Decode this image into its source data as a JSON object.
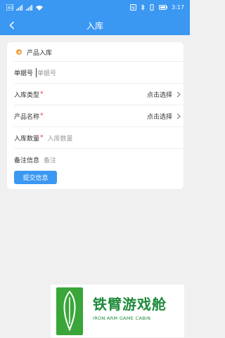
{
  "status_bar": {
    "time": "3:17",
    "battery": ""
  },
  "nav": {
    "title": "入库",
    "back_icon": "chevron-left-icon"
  },
  "card": {
    "section_title": "产品入库",
    "rows": [
      {
        "label": "单据号",
        "required": false,
        "placeholder": "单据号"
      },
      {
        "label": "入库类型",
        "required": true,
        "picker_text": "点击选择"
      },
      {
        "label": "产品名称",
        "required": true,
        "picker_text": "点击选择"
      },
      {
        "label": "入库数量",
        "required": true,
        "placeholder": "入库数量"
      },
      {
        "label": "备注信息",
        "required": false,
        "placeholder": "备注"
      }
    ],
    "submit_label": "提交信息"
  },
  "watermark": {
    "title": "铁臂游戏舱",
    "subtitle": "IRON ARM GAME CABIN"
  },
  "colors": {
    "accent": "#3a97f2",
    "required": "#e33333",
    "background": "#f0f0f0"
  }
}
